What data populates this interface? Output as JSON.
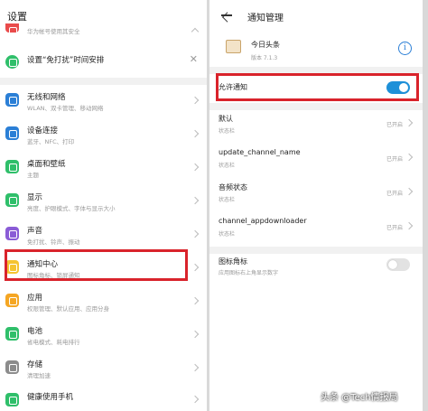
{
  "left": {
    "title": "设置",
    "rows": [
      {
        "title": "",
        "subtitle": "华为帐号使用其安全",
        "icon": "settings-partial-icon",
        "color": "#e94b4b",
        "trailing": "chevron-up"
      },
      {
        "title": "设置“免打扰”时间安排",
        "subtitle": "",
        "icon": "moon-icon",
        "color": "#2fbf6a",
        "trailing": "close"
      },
      {
        "title": "无线和网络",
        "subtitle": "WLAN、双卡管理、移动网络",
        "icon": "wifi-icon",
        "color": "#2b7fd6",
        "trailing": "chevron"
      },
      {
        "title": "设备连接",
        "subtitle": "蓝牙、NFC、打印",
        "icon": "devices-icon",
        "color": "#2b7fd6",
        "trailing": "chevron"
      },
      {
        "title": "桌面和壁纸",
        "subtitle": "主题",
        "icon": "wallpaper-icon",
        "color": "#2fbf6a",
        "trailing": "chevron"
      },
      {
        "title": "显示",
        "subtitle": "亮度、护眼模式、字体与显示大小",
        "icon": "display-icon",
        "color": "#2fbf6a",
        "trailing": "chevron"
      },
      {
        "title": "声音",
        "subtitle": "免打扰、铃声、振动",
        "icon": "sound-icon",
        "color": "#8a5cd6",
        "trailing": "chevron"
      },
      {
        "title": "通知中心",
        "subtitle": "图标角标、锁屏通知",
        "icon": "notification-icon",
        "color": "#f5c431",
        "trailing": "chevron"
      },
      {
        "title": "应用",
        "subtitle": "权限管理、默认应用、应用分身",
        "icon": "apps-icon",
        "color": "#f5a623",
        "trailing": "chevron"
      },
      {
        "title": "电池",
        "subtitle": "省电模式、耗电排行",
        "icon": "battery-icon",
        "color": "#2fbf6a",
        "trailing": "chevron"
      },
      {
        "title": "存储",
        "subtitle": "清理加速",
        "icon": "storage-icon",
        "color": "#8c8c8c",
        "trailing": "chevron"
      },
      {
        "title": "健康使用手机",
        "subtitle": "",
        "icon": "health-icon",
        "color": "#2fbf6a",
        "trailing": "chevron"
      }
    ]
  },
  "right": {
    "title": "通知管理",
    "app_name": "今日头条",
    "app_version": "版本 7.1.3",
    "allow": {
      "label": "允许通知",
      "enabled": true
    },
    "channels": [
      {
        "title": "默认",
        "subtitle": "状态栏",
        "value": "已开启"
      },
      {
        "title": "update_channel_name",
        "subtitle": "状态栏",
        "value": "已开启"
      },
      {
        "title": "音频状态",
        "subtitle": "状态栏",
        "value": "已开启"
      },
      {
        "title": "channel_appdownloader",
        "subtitle": "状态栏",
        "value": "已开启"
      }
    ],
    "badge": {
      "title": "图标角标",
      "subtitle": "应用图标右上角显示数字",
      "enabled": false
    }
  },
  "watermark": "头条 @Tech情报局",
  "colors": {
    "highlight": "#d9232b",
    "accent": "#1e90d8"
  }
}
